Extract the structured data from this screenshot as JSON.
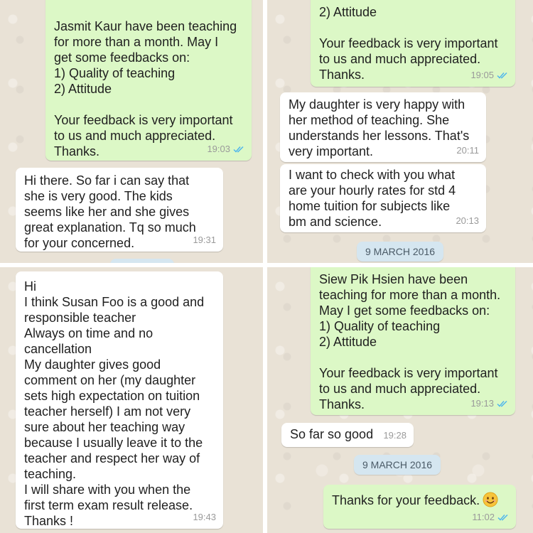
{
  "panels": {
    "top_left": {
      "out_msg": {
        "text": "Jasmit Kaur have been teaching\nfor more than a month. May I\nget some feedbacks on:\n1) Quality of teaching\n2) Attitude\n\nYour feedback is very important\nto us and much appreciated.\nThanks.",
        "time": "19:03"
      },
      "in_msg": {
        "text": "Hi there. So far i can say that\nshe is very good. The kids\nseems like her and she gives\ngreat explanation. Tq so much\nfor your concerned.",
        "time": "19:31"
      }
    },
    "top_right": {
      "out_msg": {
        "text": "2) Attitude\n\nYour feedback is very important\nto us and much appreciated.\nThanks.",
        "time": "19:05"
      },
      "in_msg_1": {
        "text": "My daughter is very happy with\nher method of teaching. She\nunderstands her lessons. That's\nvery important.",
        "time": "20:11"
      },
      "in_msg_2": {
        "text": "I want to check with you what\nare your hourly rates for std 4\nhome tuition for subjects like\nbm and science.",
        "time": "20:13"
      },
      "date": "9 MARCH 2016"
    },
    "bottom_left": {
      "in_msg": {
        "text": "Hi\nI think Susan Foo is a good and\nresponsible teacher\nAlways on time and no\ncancellation\nMy daughter gives good\ncomment on her (my daughter\nsets high expectation on tuition\nteacher herself) I am not very\nsure about her teaching way\nbecause I usually leave it to the\nteacher and respect her way of\nteaching.\nI will share with you when the\nfirst term exam result release.\nThanks !",
        "time": "19:43"
      }
    },
    "bottom_right": {
      "out_msg": {
        "text": "Siew Pik Hsien have been\nteaching for more than a month.\nMay I get some feedbacks on:\n1) Quality of teaching\n2) Attitude\n\nYour feedback is very important\nto us and much appreciated.\nThanks.",
        "time": "19:13"
      },
      "in_msg": {
        "text": "So far so good",
        "time": "19:28"
      },
      "date": "9 MARCH 2016",
      "out_msg_2": {
        "text": "Thanks for your feedback.",
        "time": "11:02",
        "emoji": "smiling-face-icon"
      }
    }
  },
  "colors": {
    "outgoing_bubble": "#dcf8c6",
    "incoming_bubble": "#ffffff",
    "read_ticks": "#4fb6ec",
    "date_pill": "#d5e6f0",
    "chat_background": "#e9e2d6"
  }
}
